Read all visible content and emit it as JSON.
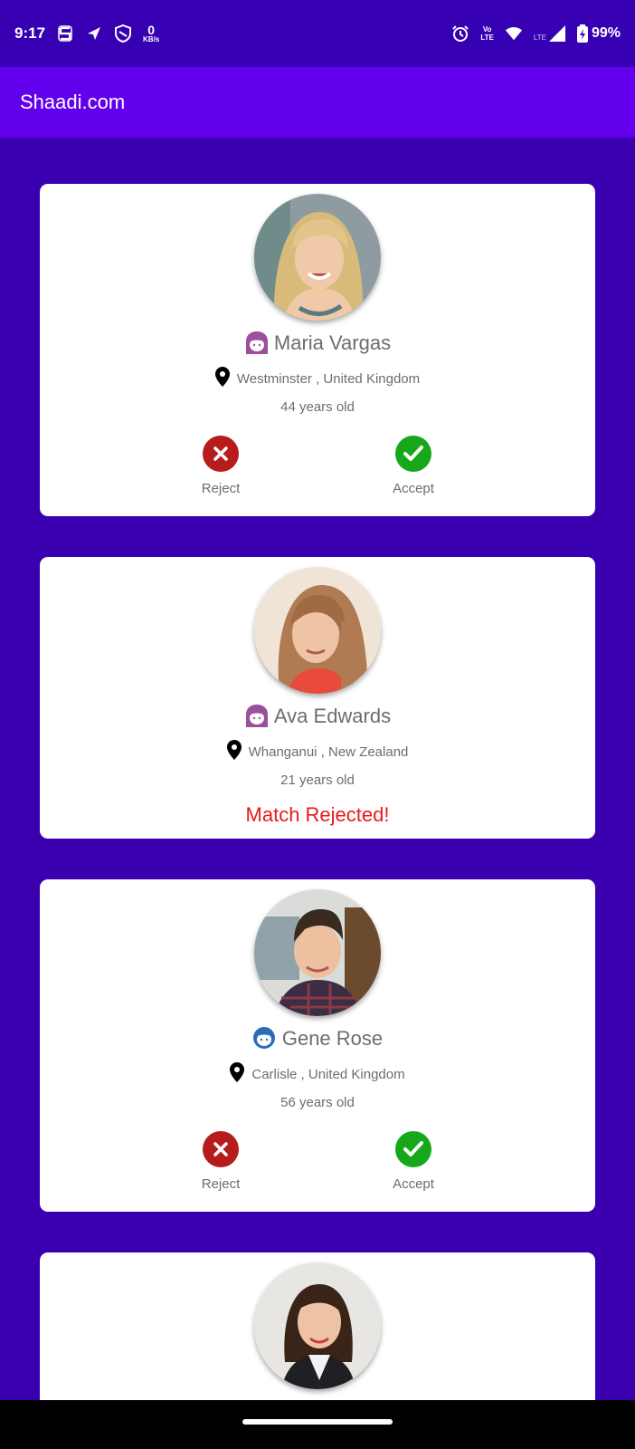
{
  "status_bar": {
    "time": "9:17",
    "kbs_value": "0",
    "kbs_unit": "KB/s",
    "volte_top": "Vo",
    "volte_bottom": "LTE",
    "lte": "LTE",
    "battery": "99%",
    "icons": [
      "s-icon",
      "navigation-icon",
      "shield-icon",
      "alarm-icon",
      "wifi-icon",
      "signal-icon",
      "battery-icon"
    ]
  },
  "app_bar": {
    "title": "Shaadi.com"
  },
  "labels": {
    "reject": "Reject",
    "accept": "Accept"
  },
  "colors": {
    "background": "#3a00b0",
    "app_bar": "#6200ee",
    "reject": "#b71c1c",
    "accept": "#16a81a",
    "rejected_text": "#e51c1c",
    "female_icon": "#9c4f9c",
    "male_icon": "#2a6db5"
  },
  "cards": [
    {
      "name": "Maria Vargas",
      "gender_icon": "female-icon",
      "location": "Westminster , United Kingdom",
      "age": "44 years old",
      "state": "pending"
    },
    {
      "name": "Ava Edwards",
      "gender_icon": "female-icon",
      "location": "Whanganui , New Zealand",
      "age": "21 years old",
      "state": "rejected",
      "status_message": "Match Rejected!"
    },
    {
      "name": "Gene Rose",
      "gender_icon": "male-icon",
      "location": "Carlisle , United Kingdom",
      "age": "56 years old",
      "state": "pending"
    },
    {
      "state": "partial"
    }
  ]
}
